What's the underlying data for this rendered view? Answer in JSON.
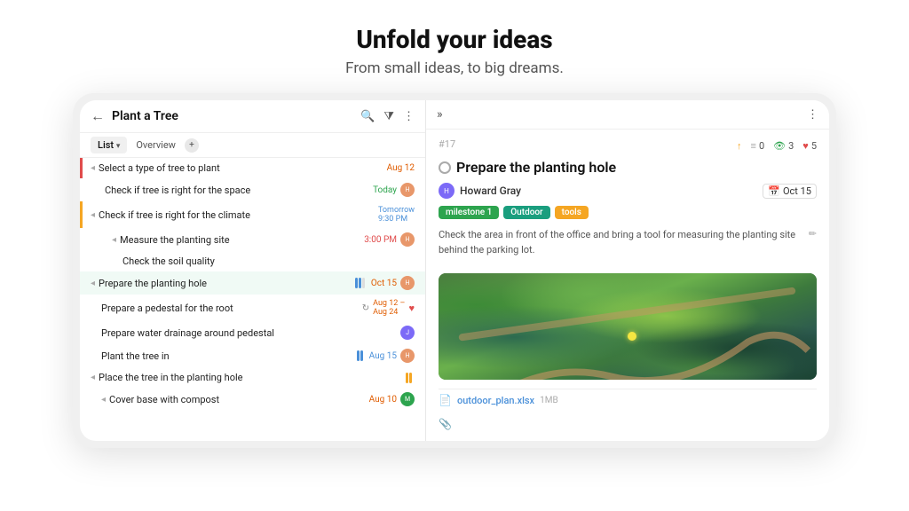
{
  "hero": {
    "title": "Unfold your ideas",
    "subtitle": "From small ideas, to big dreams."
  },
  "app": {
    "header": {
      "back_label": "←",
      "title": "Plant a Tree",
      "icons": [
        "search",
        "filter",
        "more"
      ]
    },
    "tabs": [
      {
        "label": "List",
        "active": true
      },
      {
        "label": "Overview",
        "active": false
      }
    ],
    "tasks": [
      {
        "id": 1,
        "indent": 0,
        "bullet": "◂",
        "name": "Select a type of tree to plant",
        "date": "Aug 12",
        "date_color": "orange",
        "indicator": "red"
      },
      {
        "id": 2,
        "indent": 1,
        "bullet": "",
        "name": "Check if tree is right for the space",
        "date": "Today",
        "date_color": "green",
        "has_avatar": true,
        "avatar_color": "#e8976a"
      },
      {
        "id": 3,
        "indent": 0,
        "bullet": "◂",
        "name": "Check if tree is right for the climate",
        "date": "Tomorrow 9:30 PM",
        "date_color": "blue",
        "indicator": "orange"
      },
      {
        "id": 4,
        "indent": 1,
        "bullet": "◂",
        "name": "Measure the planting site",
        "date": "3:00 PM",
        "date_color": "red",
        "has_avatar": true,
        "avatar_color": "#e8976a"
      },
      {
        "id": 5,
        "indent": 2,
        "bullet": "",
        "name": "Check the soil quality",
        "date": "",
        "date_color": ""
      },
      {
        "id": 6,
        "indent": 0,
        "bullet": "◂",
        "name": "Prepare the planting hole",
        "date": "Oct 15",
        "date_color": "orange",
        "highlighted": true,
        "has_avatar": true,
        "avatar_color": "#e8976a",
        "has_progress": true
      },
      {
        "id": 7,
        "indent": 1,
        "bullet": "",
        "name": "Prepare a pedestal for the root",
        "date": "Aug 12 – Aug 24",
        "date_color": "orange",
        "has_heart": true
      },
      {
        "id": 8,
        "indent": 1,
        "bullet": "",
        "name": "Prepare water drainage around pedestal",
        "date": "",
        "date_color": "",
        "has_avatar": true,
        "avatar_color": "#7c6af7"
      },
      {
        "id": 9,
        "indent": 1,
        "bullet": "",
        "name": "Plant the tree in",
        "date": "Aug 15",
        "date_color": "blue",
        "has_progress": true,
        "has_avatar": true,
        "avatar_color": "#e8976a"
      },
      {
        "id": 10,
        "indent": 0,
        "bullet": "◂",
        "name": "Place the tree in the planting hole",
        "date": "",
        "date_color": "",
        "has_progress2": true
      },
      {
        "id": 11,
        "indent": 1,
        "bullet": "◂",
        "name": "Cover base with compost",
        "date": "Aug 10",
        "date_color": "orange",
        "has_avatar": true,
        "avatar_color": "#2da44e"
      }
    ],
    "detail": {
      "number": "#17",
      "stats": {
        "up_count": "",
        "list_count": "0",
        "eye_count": "3",
        "heart_count": "5"
      },
      "title": "Prepare the planting hole",
      "assignee": "Howard Gray",
      "due_date": "Oct 15",
      "tags": [
        "milestone 1",
        "Outdoor",
        "tools"
      ],
      "description": "Check the area in front of the office and bring a tool for measuring the planting site behind the parking lot.",
      "file_name": "outdoor_plan.xlsx",
      "file_size": "1MB"
    }
  }
}
